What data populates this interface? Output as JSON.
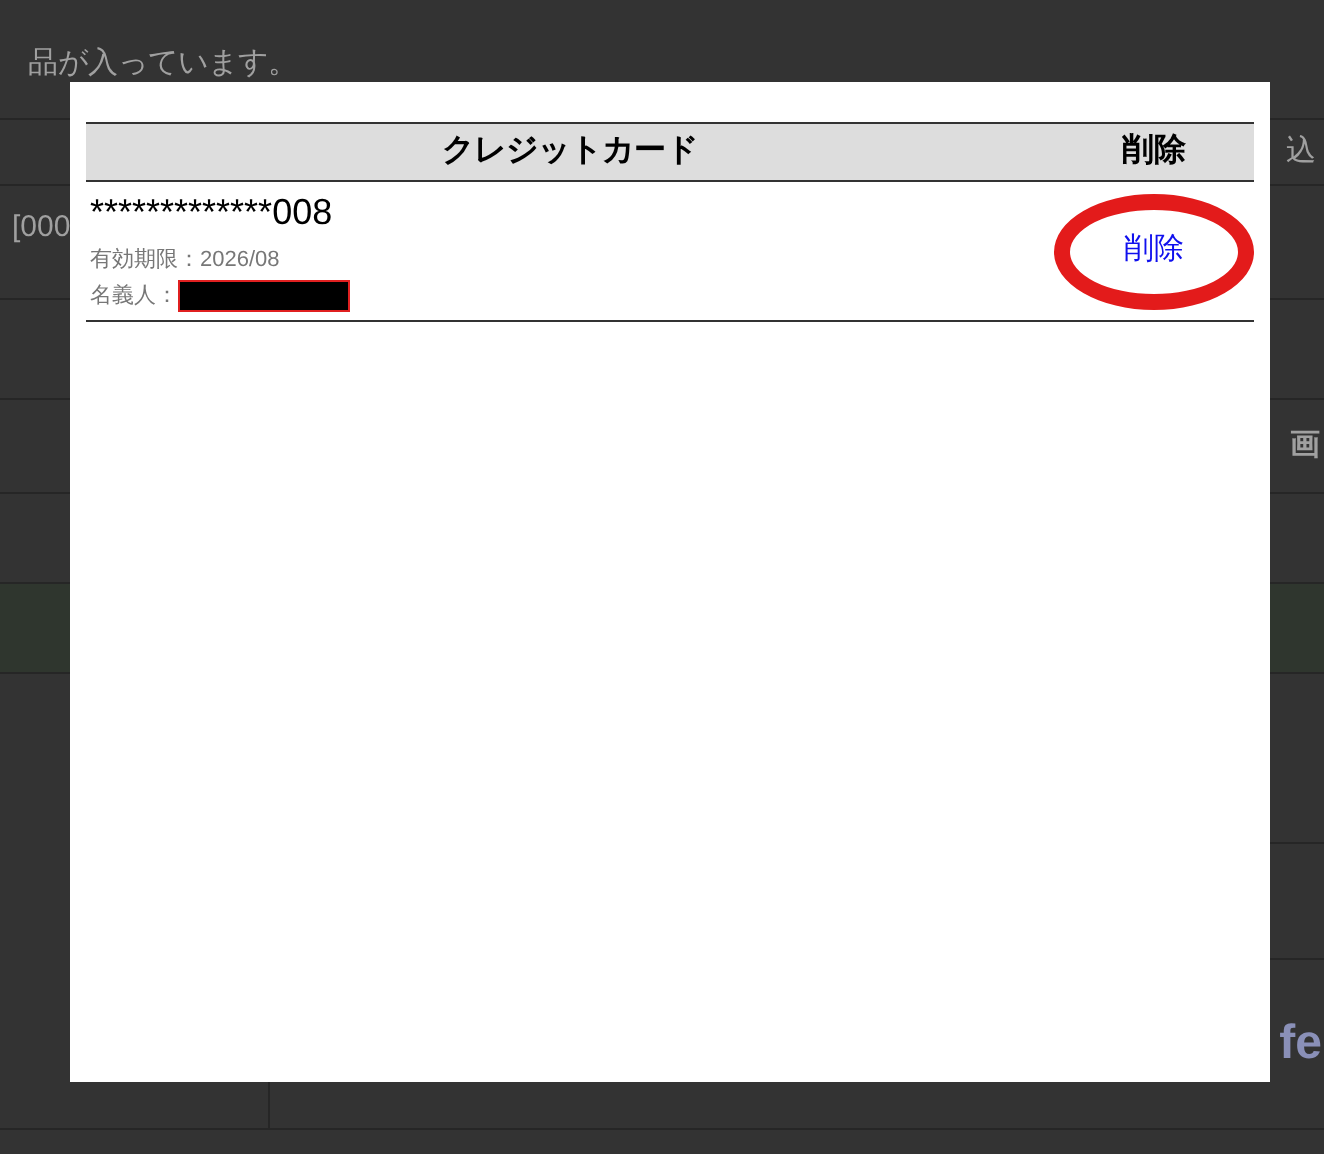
{
  "background": {
    "notice": "品が入っています。",
    "table_header_fragment": "込",
    "row_fragment": "[000",
    "screen_fragment": "画",
    "logo_fragment": "fe"
  },
  "modal": {
    "columns": [
      "クレジットカード",
      "削除"
    ],
    "cards": [
      {
        "number": "*************008",
        "expiry": "有効期限：2026/08",
        "holder_label": "名義人：",
        "delete_link": "削除",
        "highlighted": true
      }
    ]
  }
}
